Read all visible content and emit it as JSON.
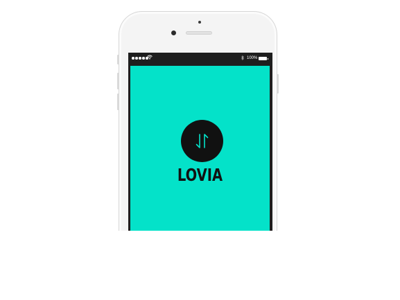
{
  "status_bar": {
    "battery_percent": "100%",
    "signal_dots": 5,
    "wifi_icon": "wifi-icon",
    "bluetooth_icon": "bluetooth-icon"
  },
  "app": {
    "brand_name": "LOVIA",
    "logo_icon": "up-down-arrows-icon",
    "background_color": "#04e2c9",
    "logo_color": "#111111",
    "accent_color": "#04e2c9"
  }
}
